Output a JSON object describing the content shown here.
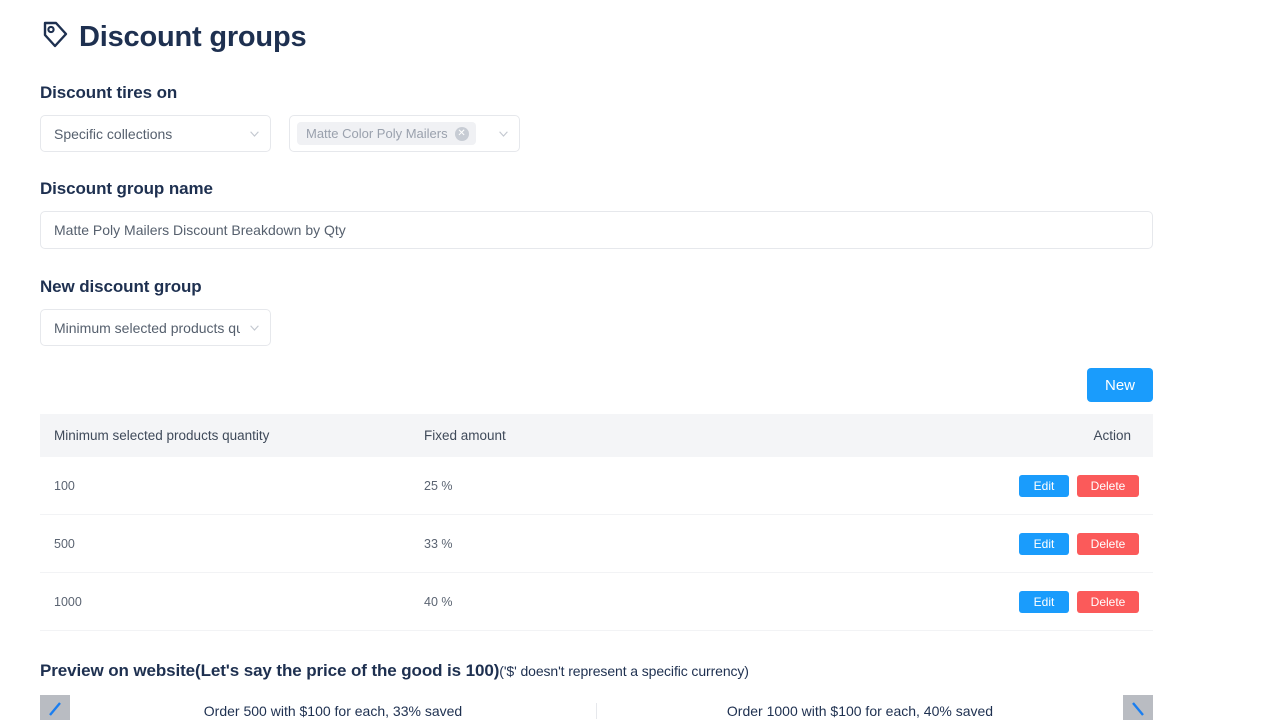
{
  "header": {
    "icon": "tag-icon",
    "title": "Discount groups"
  },
  "discount_applies": {
    "label": "Discount tires on",
    "scope_select": {
      "value": "Specific collections",
      "icon": "chevron-down-icon"
    },
    "collections_select": {
      "icon": "chevron-down-icon",
      "tags": [
        {
          "label": "Matte Color Poly Mailers",
          "remove_icon": "close-circle-icon",
          "remove_glyph": "✕"
        }
      ]
    }
  },
  "group_name": {
    "label": "Discount group name",
    "value": "Matte Poly Mailers Discount Breakdown by Qty",
    "placeholder": "Matte Poly Mailers Discount Breakdown by Qty"
  },
  "new_group": {
    "label": "New discount group",
    "type_select": {
      "value": "Minimum selected products quantity",
      "icon": "chevron-down-icon"
    },
    "new_button": "New"
  },
  "table": {
    "columns": [
      "Minimum selected products quantity",
      "Fixed amount",
      "Action"
    ],
    "rows": [
      {
        "quantity": "100",
        "amount": "25 %",
        "edit": "Edit",
        "delete": "Delete"
      },
      {
        "quantity": "500",
        "amount": "33 %",
        "edit": "Edit",
        "delete": "Delete"
      },
      {
        "quantity": "1000",
        "amount": "40 %",
        "edit": "Edit",
        "delete": "Delete"
      }
    ]
  },
  "preview": {
    "title": "Preview on website(Let's say the price of the good is 100)",
    "note": "('$' doesn't represent a specific currency)",
    "prev_icon": "arrow-left-icon",
    "next_icon": "arrow-right-icon",
    "panels": [
      {
        "text": "Order 500 with $100 for each, 33% saved"
      },
      {
        "text": "Order 1000 with $100 for each, 40% saved"
      }
    ]
  },
  "colors": {
    "primary_blue": "#1a9cfc",
    "danger_red": "#fb5a5a",
    "heading_navy": "#1e3050",
    "table_header_bg": "#f4f5f7",
    "chip_bg": "#f0f1f4"
  }
}
